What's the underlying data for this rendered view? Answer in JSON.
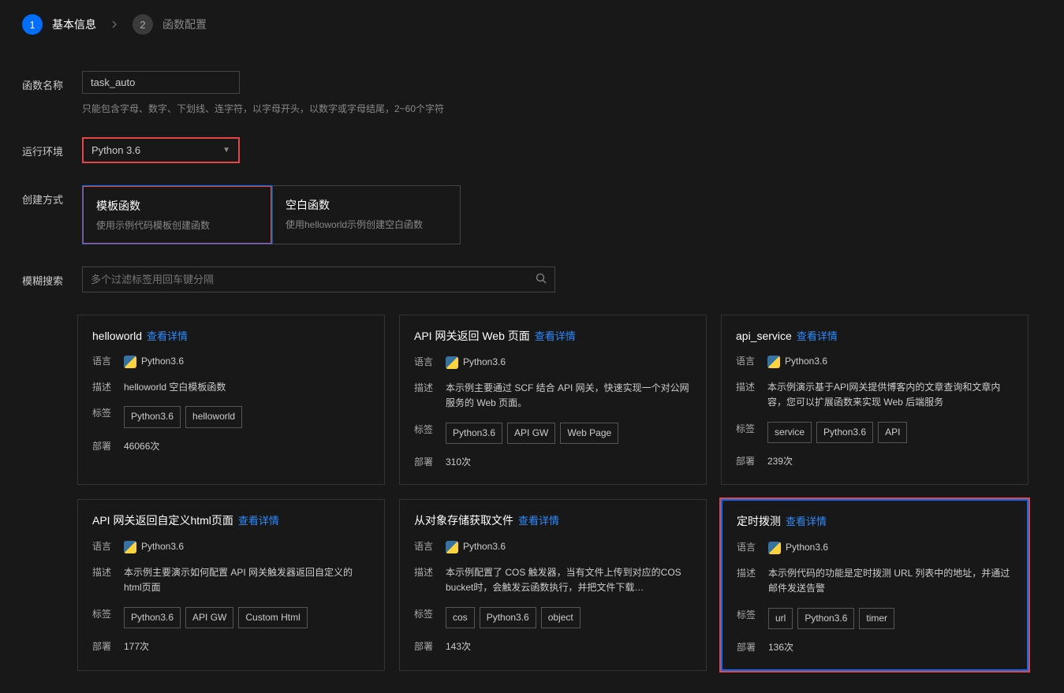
{
  "steps": {
    "s1_num": "1",
    "s1_label": "基本信息",
    "s2_num": "2",
    "s2_label": "函数配置"
  },
  "form": {
    "name_label": "函数名称",
    "name_value": "task_auto",
    "name_hint": "只能包含字母、数字、下划线、连字符，以字母开头，以数字或字母结尾，2~60个字符",
    "env_label": "运行环境",
    "env_value": "Python 3.6",
    "mode_label": "创建方式",
    "mode_template_title": "模板函数",
    "mode_template_sub": "使用示例代码模板创建函数",
    "mode_blank_title": "空白函数",
    "mode_blank_sub": "使用helloworld示例创建空白函数",
    "search_label": "模糊搜索",
    "search_placeholder": "多个过滤标签用回车键分隔"
  },
  "meta_labels": {
    "lang": "语言",
    "desc": "描述",
    "tags": "标签",
    "deploy": "部署"
  },
  "detail_link": "查看详情",
  "lang_value": "Python3.6",
  "cards": [
    {
      "title": "helloworld",
      "desc": "helloworld 空白模板函数",
      "tags": [
        "Python3.6",
        "helloworld"
      ],
      "deploy": "46066次",
      "selected": false
    },
    {
      "title": "API 网关返回 Web 页面",
      "desc": "本示例主要通过 SCF 结合 API 网关，快速实现一个对公网服务的 Web 页面。",
      "tags": [
        "Python3.6",
        "API GW",
        "Web Page"
      ],
      "deploy": "310次",
      "selected": false
    },
    {
      "title": "api_service",
      "desc": "本示例演示基于API网关提供博客内的文章查询和文章内容，您可以扩展函数来实现 Web 后端服务",
      "tags": [
        "service",
        "Python3.6",
        "API"
      ],
      "deploy": "239次",
      "selected": false
    },
    {
      "title": "API 网关返回自定义html页面",
      "desc": "本示例主要演示如何配置 API 网关触发器返回自定义的html页面",
      "tags": [
        "Python3.6",
        "API GW",
        "Custom Html"
      ],
      "deploy": "177次",
      "selected": false
    },
    {
      "title": "从对象存储获取文件",
      "desc": "本示例配置了 COS 触发器，当有文件上传到对应的COS bucket时，会触发云函数执行，并把文件下载…",
      "tags": [
        "cos",
        "Python3.6",
        "object"
      ],
      "deploy": "143次",
      "selected": false
    },
    {
      "title": "定时拨测",
      "desc": "本示例代码的功能是定时拨测 URL 列表中的地址，并通过邮件发送告警",
      "tags": [
        "url",
        "Python3.6",
        "timer"
      ],
      "deploy": "136次",
      "selected": true
    }
  ]
}
